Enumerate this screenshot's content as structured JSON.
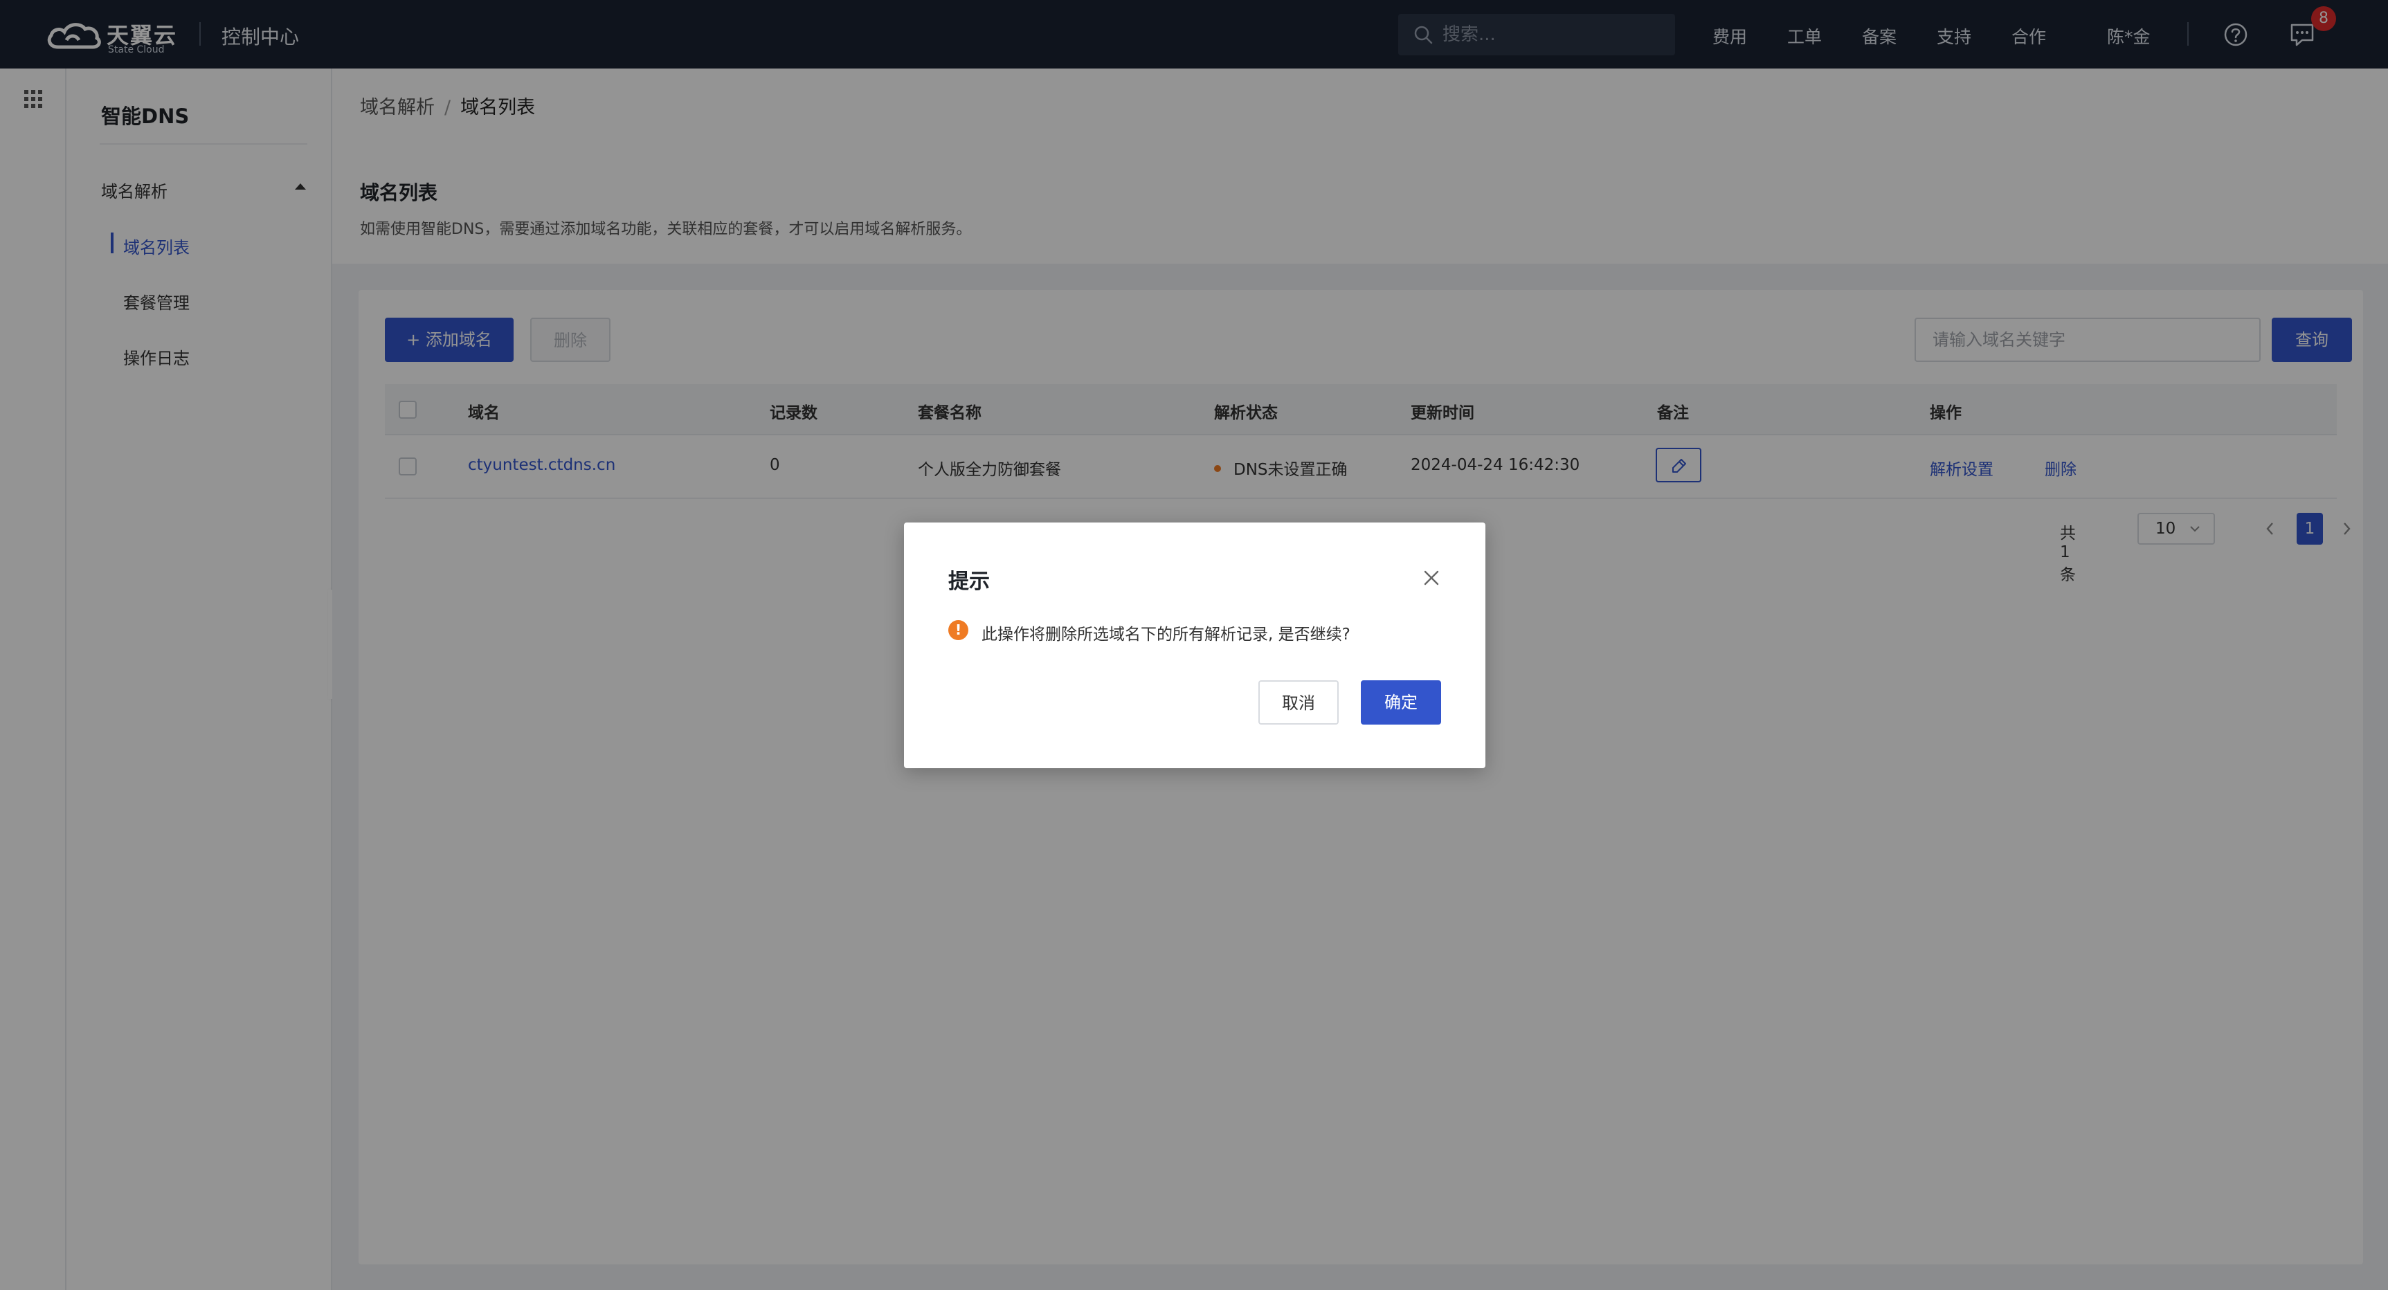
{
  "colors": {
    "topbar": "#1a2433",
    "primary": "#3355cc",
    "warning": "#ef7b24",
    "danger_badge": "#e02b2b"
  },
  "topbar": {
    "brand_main": "天翼云",
    "brand_sub": "State Cloud",
    "console_title": "控制中心",
    "search_placeholder": "搜索...",
    "nav": [
      "费用",
      "工单",
      "备案",
      "支持",
      "合作"
    ],
    "user": "陈*金",
    "message_badge": "8"
  },
  "sidebar": {
    "title": "智能DNS",
    "group": "域名解析",
    "items": [
      "域名列表",
      "套餐管理",
      "操作日志"
    ],
    "active_item": "域名列表"
  },
  "breadcrumb": {
    "parent": "域名解析",
    "current": "域名列表"
  },
  "page": {
    "title": "域名列表",
    "description": "如需使用智能DNS，需要通过添加域名功能，关联相应的套餐，才可以启用域名解析服务。"
  },
  "toolbar": {
    "add_label": "+ 添加域名",
    "delete_label": "删除",
    "keyword_placeholder": "请输入域名关键字",
    "query_label": "查询"
  },
  "table": {
    "headers": [
      "域名",
      "记录数",
      "套餐名称",
      "解析状态",
      "更新时间",
      "备注",
      "操作"
    ],
    "rows": [
      {
        "domain": "ctyuntest.ctdns.cn",
        "records": "0",
        "package": "个人版全力防御套餐",
        "status": "DNS未设置正确",
        "updated": "2024-04-24 16:42:30",
        "actions": [
          "解析设置",
          "删除"
        ]
      }
    ]
  },
  "pagination": {
    "total": "共1条",
    "page_size": "10",
    "current_page": "1"
  },
  "dialog": {
    "title": "提示",
    "message": "此操作将删除所选域名下的所有解析记录, 是否继续?",
    "warn_glyph": "!",
    "cancel_label": "取消",
    "confirm_label": "确定"
  }
}
